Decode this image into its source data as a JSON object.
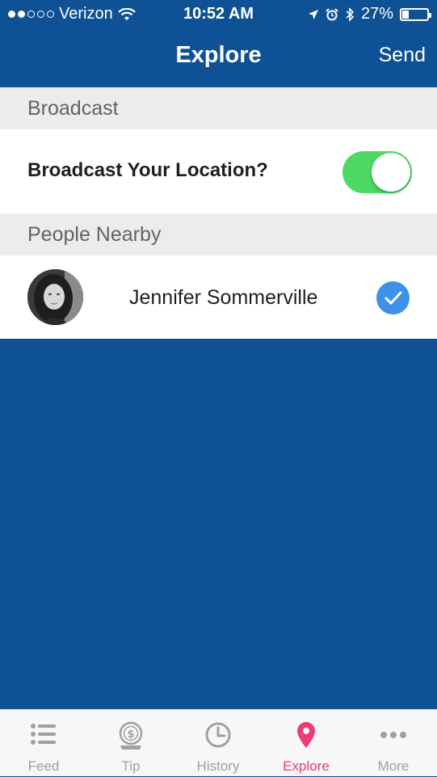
{
  "status_bar": {
    "carrier": "Verizon",
    "time": "10:52 AM",
    "battery": "27%",
    "battery_level": 0.27,
    "signal_bars_filled": 2,
    "signal_bars_total": 5
  },
  "nav": {
    "title": "Explore",
    "send_label": "Send"
  },
  "broadcast_section": {
    "header": "Broadcast",
    "toggle_label": "Broadcast Your Location?",
    "toggle_on": true
  },
  "nearby_section": {
    "header": "People Nearby",
    "people": [
      {
        "name": "Jennifer Sommerville",
        "selected": true
      }
    ]
  },
  "tabs": [
    {
      "label": "Feed",
      "icon": "list-icon",
      "active": false
    },
    {
      "label": "Tip",
      "icon": "dollar-coin-icon",
      "active": false
    },
    {
      "label": "History",
      "icon": "clock-icon",
      "active": false
    },
    {
      "label": "Explore",
      "icon": "location-pin-icon",
      "active": true
    },
    {
      "label": "More",
      "icon": "more-dots-icon",
      "active": false
    }
  ],
  "colors": {
    "nav_blue": "#0e5194",
    "toggle_green": "#4cd964",
    "check_blue": "#3d92e8",
    "active_tab_pink": "#ea3d73",
    "inactive_tab_gray": "#a0a0a0"
  }
}
